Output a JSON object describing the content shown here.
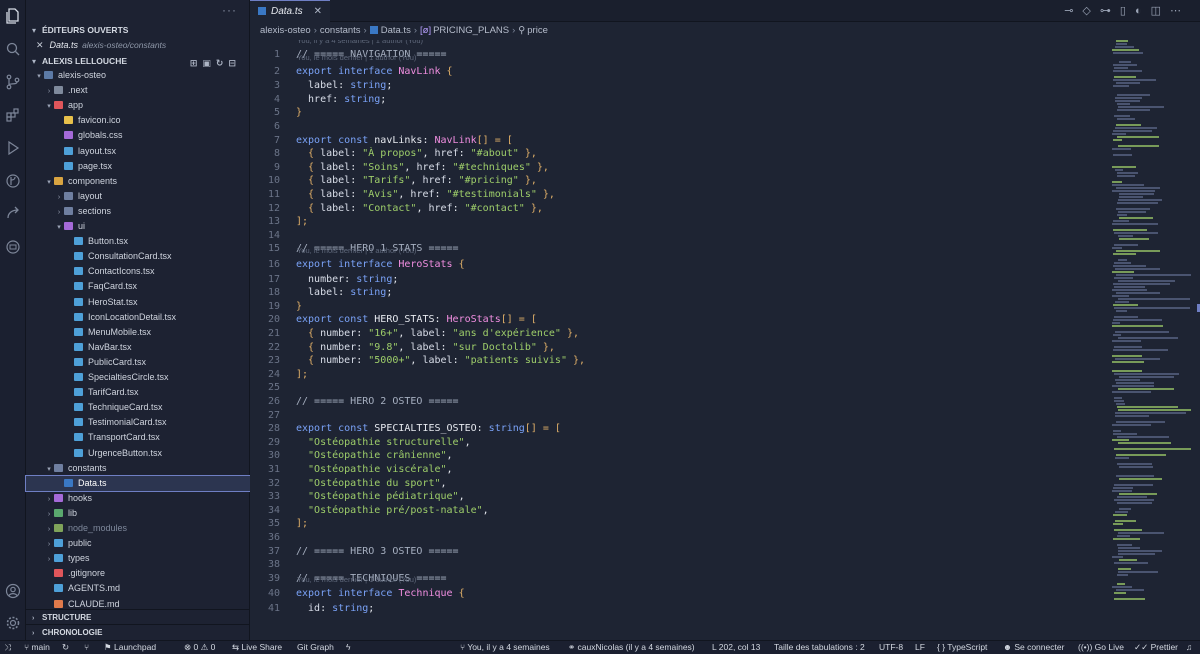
{
  "sidebar": {
    "open_editors_title": "ÉDITEURS OUVERTS",
    "open_file": {
      "name": "Data.ts",
      "path": "alexis-osteo/constants"
    },
    "workspace_title": "ALEXIS LELLOUCHE",
    "tree": [
      {
        "label": "alexis-osteo",
        "depth": 0,
        "twisty": "open",
        "color": "#5c7aa6",
        "dim": false
      },
      {
        "label": ".next",
        "depth": 1,
        "twisty": "closed",
        "color": "#7f8a9c",
        "dim": false
      },
      {
        "label": "app",
        "depth": 1,
        "twisty": "open",
        "color": "#e0565b",
        "dim": false
      },
      {
        "label": "favicon.ico",
        "depth": 2,
        "twisty": "",
        "color": "#e8c14b",
        "dim": false
      },
      {
        "label": "globals.css",
        "depth": 2,
        "twisty": "",
        "color": "#a56ad8",
        "dim": false
      },
      {
        "label": "layout.tsx",
        "depth": 2,
        "twisty": "",
        "color": "#4ea0d8",
        "dim": false
      },
      {
        "label": "page.tsx",
        "depth": 2,
        "twisty": "",
        "color": "#4ea0d8",
        "dim": false
      },
      {
        "label": "components",
        "depth": 1,
        "twisty": "open",
        "color": "#d9a441",
        "dim": false
      },
      {
        "label": "layout",
        "depth": 2,
        "twisty": "closed",
        "color": "#6f7fa0",
        "dim": false
      },
      {
        "label": "sections",
        "depth": 2,
        "twisty": "closed",
        "color": "#6f7fa0",
        "dim": false
      },
      {
        "label": "ui",
        "depth": 2,
        "twisty": "open",
        "color": "#a56ad8",
        "dim": false
      },
      {
        "label": "Button.tsx",
        "depth": 3,
        "twisty": "",
        "color": "#4ea0d8",
        "dim": false
      },
      {
        "label": "ConsultationCard.tsx",
        "depth": 3,
        "twisty": "",
        "color": "#4ea0d8",
        "dim": false
      },
      {
        "label": "ContactIcons.tsx",
        "depth": 3,
        "twisty": "",
        "color": "#4ea0d8",
        "dim": false
      },
      {
        "label": "FaqCard.tsx",
        "depth": 3,
        "twisty": "",
        "color": "#4ea0d8",
        "dim": false
      },
      {
        "label": "HeroStat.tsx",
        "depth": 3,
        "twisty": "",
        "color": "#4ea0d8",
        "dim": false
      },
      {
        "label": "IconLocationDetail.tsx",
        "depth": 3,
        "twisty": "",
        "color": "#4ea0d8",
        "dim": false
      },
      {
        "label": "MenuMobile.tsx",
        "depth": 3,
        "twisty": "",
        "color": "#4ea0d8",
        "dim": false
      },
      {
        "label": "NavBar.tsx",
        "depth": 3,
        "twisty": "",
        "color": "#4ea0d8",
        "dim": false
      },
      {
        "label": "PublicCard.tsx",
        "depth": 3,
        "twisty": "",
        "color": "#4ea0d8",
        "dim": false
      },
      {
        "label": "SpecialtiesCircle.tsx",
        "depth": 3,
        "twisty": "",
        "color": "#4ea0d8",
        "dim": false
      },
      {
        "label": "TarifCard.tsx",
        "depth": 3,
        "twisty": "",
        "color": "#4ea0d8",
        "dim": false
      },
      {
        "label": "TechniqueCard.tsx",
        "depth": 3,
        "twisty": "",
        "color": "#4ea0d8",
        "dim": false
      },
      {
        "label": "TestimonialCard.tsx",
        "depth": 3,
        "twisty": "",
        "color": "#4ea0d8",
        "dim": false
      },
      {
        "label": "TransportCard.tsx",
        "depth": 3,
        "twisty": "",
        "color": "#4ea0d8",
        "dim": false
      },
      {
        "label": "UrgenceButton.tsx",
        "depth": 3,
        "twisty": "",
        "color": "#4ea0d8",
        "dim": false
      },
      {
        "label": "constants",
        "depth": 1,
        "twisty": "open",
        "color": "#6f7fa0",
        "dim": false
      },
      {
        "label": "Data.ts",
        "depth": 2,
        "twisty": "",
        "color": "#3a78c4",
        "dim": false,
        "selected": true
      },
      {
        "label": "hooks",
        "depth": 1,
        "twisty": "closed",
        "color": "#a56ad8",
        "dim": false
      },
      {
        "label": "lib",
        "depth": 1,
        "twisty": "closed",
        "color": "#5aa86e",
        "dim": false
      },
      {
        "label": "node_modules",
        "depth": 1,
        "twisty": "closed",
        "color": "#7fa35a",
        "dim": true
      },
      {
        "label": "public",
        "depth": 1,
        "twisty": "closed",
        "color": "#4ea0d8",
        "dim": false
      },
      {
        "label": "types",
        "depth": 1,
        "twisty": "closed",
        "color": "#4ea0d8",
        "dim": false
      },
      {
        "label": ".gitignore",
        "depth": 1,
        "twisty": "",
        "color": "#e0565b",
        "dim": false
      },
      {
        "label": "AGENTS.md",
        "depth": 1,
        "twisty": "",
        "color": "#4ea0d8",
        "dim": false
      },
      {
        "label": "CLAUDE.md",
        "depth": 1,
        "twisty": "",
        "color": "#e07a4b",
        "dim": false
      }
    ],
    "structure_title": "STRUCTURE",
    "timeline_title": "CHRONOLOGIE"
  },
  "tab": {
    "label": "Data.ts"
  },
  "breadcrumb": {
    "parts": [
      "alexis-osteo",
      "constants",
      "Data.ts",
      "PRICING_PLANS",
      "price"
    ]
  },
  "blame": {
    "top": "You, il y a 4 semaines | 1 author (You)",
    "recent": "You, le mois dernier | 1 author (You)"
  },
  "code_lines": [
    {
      "n": 1,
      "lens": "top",
      "tokens": [
        [
          "c",
          "// ===== NAVIGATION ====="
        ]
      ]
    },
    {
      "n": 2,
      "lens": "recent",
      "tokens": [
        [
          "k",
          "export "
        ],
        [
          "k",
          "interface "
        ],
        [
          "t",
          "NavLink"
        ],
        [
          "p",
          " {"
        ]
      ]
    },
    {
      "n": 3,
      "tokens": [
        [
          "pr",
          "  label"
        ],
        [
          "v",
          ": "
        ],
        [
          "k",
          "string"
        ],
        [
          "v",
          ";"
        ]
      ]
    },
    {
      "n": 4,
      "tokens": [
        [
          "pr",
          "  href"
        ],
        [
          "v",
          ": "
        ],
        [
          "k",
          "string"
        ],
        [
          "v",
          ";"
        ]
      ]
    },
    {
      "n": 5,
      "tokens": [
        [
          "p",
          "}"
        ]
      ]
    },
    {
      "n": 6,
      "tokens": []
    },
    {
      "n": 7,
      "tokens": [
        [
          "k",
          "export "
        ],
        [
          "k",
          "const "
        ],
        [
          "v",
          "navLinks: "
        ],
        [
          "t",
          "NavLink"
        ],
        [
          "p",
          "[] = ["
        ]
      ]
    },
    {
      "n": 8,
      "tokens": [
        [
          "p",
          "  { "
        ],
        [
          "pr",
          "label"
        ],
        [
          "v",
          ": "
        ],
        [
          "s",
          "\"À propos\""
        ],
        [
          "v",
          ", "
        ],
        [
          "pr",
          "href"
        ],
        [
          "v",
          ": "
        ],
        [
          "s",
          "\"#about\""
        ],
        [
          "p",
          " },"
        ]
      ]
    },
    {
      "n": 9,
      "tokens": [
        [
          "p",
          "  { "
        ],
        [
          "pr",
          "label"
        ],
        [
          "v",
          ": "
        ],
        [
          "s",
          "\"Soins\""
        ],
        [
          "v",
          ", "
        ],
        [
          "pr",
          "href"
        ],
        [
          "v",
          ": "
        ],
        [
          "s",
          "\"#techniques\""
        ],
        [
          "p",
          " },"
        ]
      ]
    },
    {
      "n": 10,
      "tokens": [
        [
          "p",
          "  { "
        ],
        [
          "pr",
          "label"
        ],
        [
          "v",
          ": "
        ],
        [
          "s",
          "\"Tarifs\""
        ],
        [
          "v",
          ", "
        ],
        [
          "pr",
          "href"
        ],
        [
          "v",
          ": "
        ],
        [
          "s",
          "\"#pricing\""
        ],
        [
          "p",
          " },"
        ]
      ]
    },
    {
      "n": 11,
      "tokens": [
        [
          "p",
          "  { "
        ],
        [
          "pr",
          "label"
        ],
        [
          "v",
          ": "
        ],
        [
          "s",
          "\"Avis\""
        ],
        [
          "v",
          ", "
        ],
        [
          "pr",
          "href"
        ],
        [
          "v",
          ": "
        ],
        [
          "s",
          "\"#testimonials\""
        ],
        [
          "p",
          " },"
        ]
      ]
    },
    {
      "n": 12,
      "tokens": [
        [
          "p",
          "  { "
        ],
        [
          "pr",
          "label"
        ],
        [
          "v",
          ": "
        ],
        [
          "s",
          "\"Contact\""
        ],
        [
          "v",
          ", "
        ],
        [
          "pr",
          "href"
        ],
        [
          "v",
          ": "
        ],
        [
          "s",
          "\"#contact\""
        ],
        [
          "p",
          " },"
        ]
      ]
    },
    {
      "n": 13,
      "tokens": [
        [
          "p",
          "];"
        ]
      ]
    },
    {
      "n": 14,
      "tokens": []
    },
    {
      "n": 15,
      "tokens": [
        [
          "c",
          "// ===== HERO 1 STATS ====="
        ]
      ]
    },
    {
      "n": 16,
      "lens": "recent",
      "tokens": [
        [
          "k",
          "export "
        ],
        [
          "k",
          "interface "
        ],
        [
          "t",
          "HeroStats"
        ],
        [
          "p",
          " {"
        ]
      ]
    },
    {
      "n": 17,
      "tokens": [
        [
          "pr",
          "  number"
        ],
        [
          "v",
          ": "
        ],
        [
          "k",
          "string"
        ],
        [
          "v",
          ";"
        ]
      ]
    },
    {
      "n": 18,
      "tokens": [
        [
          "pr",
          "  label"
        ],
        [
          "v",
          ": "
        ],
        [
          "k",
          "string"
        ],
        [
          "v",
          ";"
        ]
      ]
    },
    {
      "n": 19,
      "tokens": [
        [
          "p",
          "}"
        ]
      ]
    },
    {
      "n": 20,
      "tokens": [
        [
          "k",
          "export "
        ],
        [
          "k",
          "const "
        ],
        [
          "v",
          "HERO_STATS: "
        ],
        [
          "t",
          "HeroStats"
        ],
        [
          "p",
          "[] = ["
        ]
      ]
    },
    {
      "n": 21,
      "tokens": [
        [
          "p",
          "  { "
        ],
        [
          "pr",
          "number"
        ],
        [
          "v",
          ": "
        ],
        [
          "s",
          "\"16+\""
        ],
        [
          "v",
          ", "
        ],
        [
          "pr",
          "label"
        ],
        [
          "v",
          ": "
        ],
        [
          "s",
          "\"ans d'expérience\""
        ],
        [
          "p",
          " },"
        ]
      ]
    },
    {
      "n": 22,
      "tokens": [
        [
          "p",
          "  { "
        ],
        [
          "pr",
          "number"
        ],
        [
          "v",
          ": "
        ],
        [
          "s",
          "\"9.8\""
        ],
        [
          "v",
          ", "
        ],
        [
          "pr",
          "label"
        ],
        [
          "v",
          ": "
        ],
        [
          "s",
          "\"sur Doctolib\""
        ],
        [
          "p",
          " },"
        ]
      ]
    },
    {
      "n": 23,
      "tokens": [
        [
          "p",
          "  { "
        ],
        [
          "pr",
          "number"
        ],
        [
          "v",
          ": "
        ],
        [
          "s",
          "\"5000+\""
        ],
        [
          "v",
          ", "
        ],
        [
          "pr",
          "label"
        ],
        [
          "v",
          ": "
        ],
        [
          "s",
          "\"patients suivis\""
        ],
        [
          "p",
          " },"
        ]
      ]
    },
    {
      "n": 24,
      "tokens": [
        [
          "p",
          "];"
        ]
      ]
    },
    {
      "n": 25,
      "tokens": []
    },
    {
      "n": 26,
      "tokens": [
        [
          "c",
          "// ===== HERO 2 OSTEO ====="
        ]
      ]
    },
    {
      "n": 27,
      "tokens": []
    },
    {
      "n": 28,
      "tokens": [
        [
          "k",
          "export "
        ],
        [
          "k",
          "const "
        ],
        [
          "v",
          "SPECIALTIES_OSTEO: "
        ],
        [
          "k",
          "string"
        ],
        [
          "p",
          "[] = ["
        ]
      ]
    },
    {
      "n": 29,
      "tokens": [
        [
          "s",
          "  \"Ostéopathie structurelle\""
        ],
        [
          "v",
          ","
        ]
      ]
    },
    {
      "n": 30,
      "tokens": [
        [
          "s",
          "  \"Ostéopathie crânienne\""
        ],
        [
          "v",
          ","
        ]
      ]
    },
    {
      "n": 31,
      "tokens": [
        [
          "s",
          "  \"Ostéopathie viscérale\""
        ],
        [
          "v",
          ","
        ]
      ]
    },
    {
      "n": 32,
      "tokens": [
        [
          "s",
          "  \"Ostéopathie du sport\""
        ],
        [
          "v",
          ","
        ]
      ]
    },
    {
      "n": 33,
      "tokens": [
        [
          "s",
          "  \"Ostéopathie pédiatrique\""
        ],
        [
          "v",
          ","
        ]
      ]
    },
    {
      "n": 34,
      "tokens": [
        [
          "s",
          "  \"Ostéopathie pré/post-natale\""
        ],
        [
          "v",
          ","
        ]
      ]
    },
    {
      "n": 35,
      "tokens": [
        [
          "p",
          "];"
        ]
      ]
    },
    {
      "n": 36,
      "tokens": []
    },
    {
      "n": 37,
      "tokens": [
        [
          "c",
          "// ===== HERO 3 OSTEO ====="
        ]
      ]
    },
    {
      "n": 38,
      "tokens": []
    },
    {
      "n": 39,
      "tokens": [
        [
          "c",
          "// ===== TECHNIQUES ====="
        ]
      ]
    },
    {
      "n": 40,
      "lens": "recent",
      "tokens": [
        [
          "k",
          "export "
        ],
        [
          "k",
          "interface "
        ],
        [
          "t",
          "Technique"
        ],
        [
          "p",
          " {"
        ]
      ]
    },
    {
      "n": 41,
      "tokens": [
        [
          "pr",
          "  id"
        ],
        [
          "v",
          ": "
        ],
        [
          "k",
          "string"
        ],
        [
          "v",
          ";"
        ]
      ]
    }
  ],
  "status": {
    "branch": "main",
    "launchpad": "Launchpad",
    "errors": "0",
    "warnings": "0",
    "live_share": "Live Share",
    "git_graph": "Git Graph",
    "blame": "You, il y a 4 semaines",
    "author": "cauxNicolas (il y a 4 semaines)",
    "position": "L 202, col 13",
    "tab_size": "Taille des tabulations : 2",
    "encoding": "UTF-8",
    "eol": "LF",
    "language": "TypeScript",
    "connect": "Se connecter",
    "go_live": "Go Live",
    "prettier": "Prettier"
  }
}
